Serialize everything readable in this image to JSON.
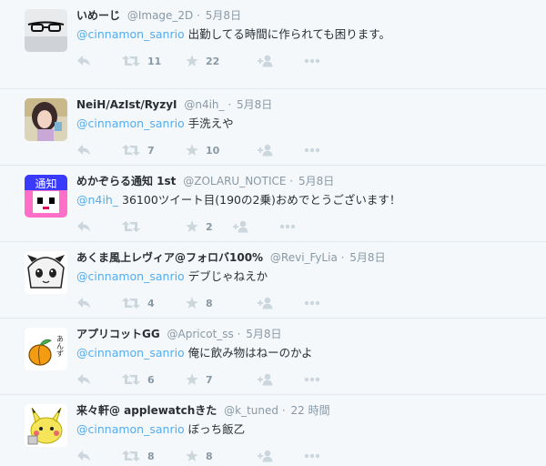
{
  "colors": {
    "background": "#f5f8fa",
    "link": "#55acee",
    "muted": "#8899a6",
    "icon": "#ccd6dd",
    "divider": "#e1e8ed"
  },
  "tweets": [
    {
      "name": "いめーじ",
      "handle": "@Image_2D",
      "time": "5月8日",
      "mention": "@cinnamon_sanrio",
      "text": " 出勤してる時間に作られても困ります。",
      "retweets": "11",
      "favorites": "22",
      "avatar_icon": "glasses-avatar-icon"
    },
    {
      "name": "NeiH/AzIst/RyzyI",
      "handle": "@n4ih_",
      "time": "5月8日",
      "mention": "@cinnamon_sanrio",
      "text": " 手洗えや",
      "retweets": "7",
      "favorites": "10",
      "avatar_icon": "photo-avatar-icon"
    },
    {
      "name": "めかぞらる通知 1st",
      "handle": "@ZOLARU_NOTICE",
      "time": "5月8日",
      "mention": "@n4ih_",
      "text": " 36100ツイート目(190の2乗)おめでとうございます！",
      "retweets": "",
      "favorites": "2",
      "avatar_icon": "pixel-character-avatar-icon",
      "avatar_text": "通知"
    },
    {
      "name": "あくま風上レヴィア@フォロバ100%",
      "handle": "@Revi_FyLia",
      "time": "5月8日",
      "mention": "@cinnamon_sanrio",
      "text": " デブじゃねえか",
      "retweets": "4",
      "favorites": "8",
      "avatar_icon": "anime-girl-avatar-icon"
    },
    {
      "name": "アプリコットGG",
      "handle": "@Apricot_ss",
      "time": "5月8日",
      "mention": "@cinnamon_sanrio",
      "text": " 俺に飲み物はねーのかよ",
      "retweets": "6",
      "favorites": "7",
      "avatar_icon": "apricot-avatar-icon",
      "avatar_text": "あんず"
    },
    {
      "name": "来々軒@ applewatchきた",
      "handle": "@k_tuned",
      "time": "22 時間",
      "mention": "@cinnamon_sanrio",
      "text": " ぼっち飯乙",
      "retweets": "8",
      "favorites": "8",
      "avatar_icon": "yellow-character-avatar-icon"
    }
  ]
}
